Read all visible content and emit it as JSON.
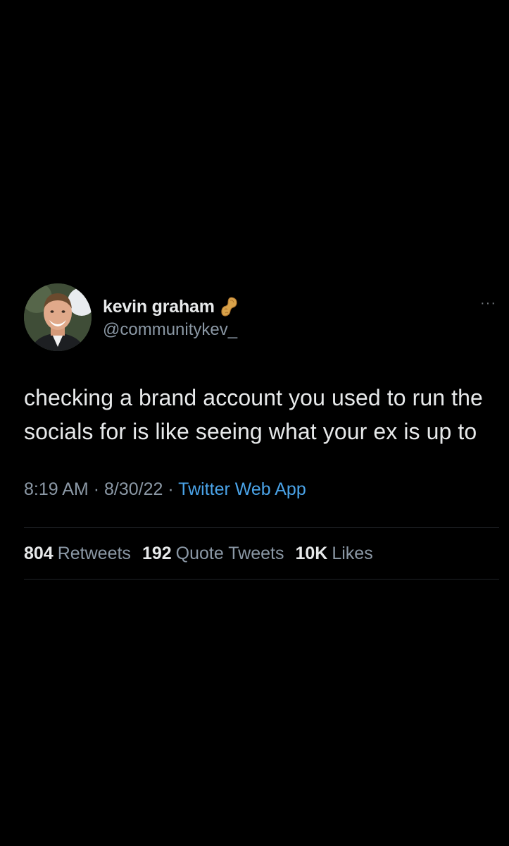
{
  "tweet": {
    "author": {
      "display_name": "kevin graham",
      "handle": "@communitykev_",
      "badge_icon": "peanut-icon"
    },
    "more_icon": "more-options-icon",
    "text": "checking a brand account you used to run the socials for is like seeing what your ex is up to",
    "time": "8:19 AM",
    "separator": "·",
    "date": "8/30/22",
    "source": "Twitter Web App",
    "stats": {
      "retweets": {
        "count": "804",
        "label": "Retweets"
      },
      "quotes": {
        "count": "192",
        "label": "Quote Tweets"
      },
      "likes": {
        "count": "10K",
        "label": "Likes"
      }
    }
  },
  "colors": {
    "background": "#000000",
    "text_primary": "#e7e9ea",
    "text_secondary": "#8b98a5",
    "link": "#4aa3e8",
    "divider": "#1f2327"
  }
}
